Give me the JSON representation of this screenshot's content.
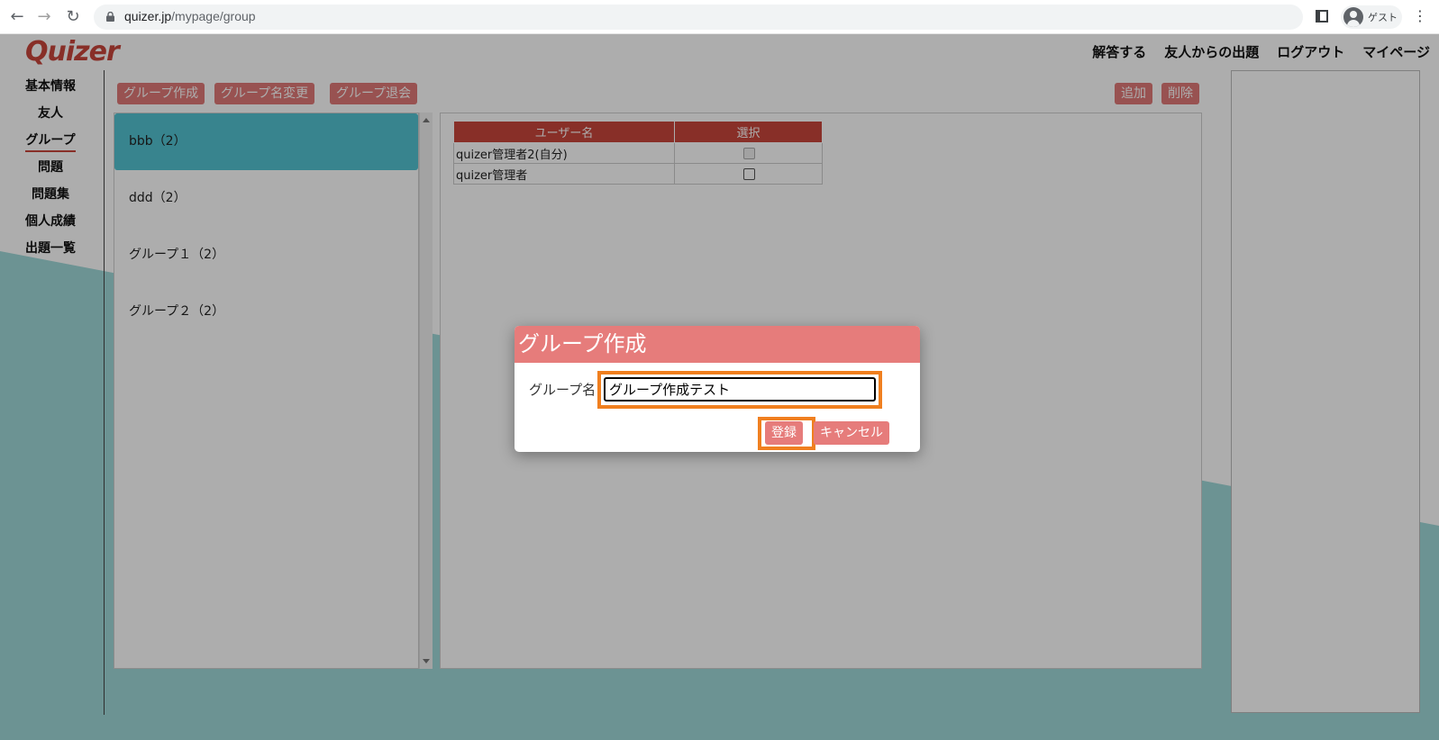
{
  "browser": {
    "url_host": "quizer.jp",
    "url_path": "/mypage/group",
    "profile_name": "ゲスト"
  },
  "logo": "Quizer",
  "topnav": [
    "解答する",
    "友人からの出題",
    "ログアウト",
    "マイページ"
  ],
  "sidebar": {
    "items": [
      "基本情報",
      "友人",
      "グループ",
      "問題",
      "問題集",
      "個人成績",
      "出題一覧"
    ],
    "active": "グループ"
  },
  "toolbar": {
    "create": "グループ作成",
    "rename": "グループ名変更",
    "leave": "グループ退会",
    "add": "追加",
    "delete": "削除"
  },
  "groups": [
    {
      "label": "bbb（2）",
      "selected": true
    },
    {
      "label": "ddd（2）",
      "selected": false
    },
    {
      "label": "グループ１（2）",
      "selected": false
    },
    {
      "label": "グループ２（2）",
      "selected": false
    }
  ],
  "members_table": {
    "headers": [
      "ユーザー名",
      "選択"
    ],
    "rows": [
      {
        "name": "quizer管理者2(自分)",
        "checkbox_disabled": true
      },
      {
        "name": "quizer管理者",
        "checkbox_disabled": false
      }
    ]
  },
  "modal": {
    "title": "グループ作成",
    "field_label": "グループ名",
    "field_value": "グループ作成テスト",
    "submit": "登録",
    "cancel": "キャンセル"
  },
  "colors": {
    "brand": "#c9463c",
    "button": "#e07a78",
    "selected_group": "#53c3d2",
    "highlight": "#f07f1f",
    "teal_background": "#9fd9d9"
  }
}
